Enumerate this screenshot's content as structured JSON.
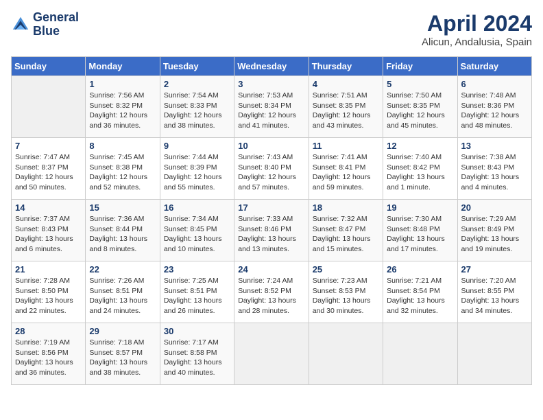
{
  "logo": {
    "line1": "General",
    "line2": "Blue"
  },
  "title": "April 2024",
  "subtitle": "Alicun, Andalusia, Spain",
  "days_header": [
    "Sunday",
    "Monday",
    "Tuesday",
    "Wednesday",
    "Thursday",
    "Friday",
    "Saturday"
  ],
  "weeks": [
    [
      {
        "num": "",
        "sunrise": "",
        "sunset": "",
        "daylight": ""
      },
      {
        "num": "1",
        "sunrise": "Sunrise: 7:56 AM",
        "sunset": "Sunset: 8:32 PM",
        "daylight": "Daylight: 12 hours and 36 minutes."
      },
      {
        "num": "2",
        "sunrise": "Sunrise: 7:54 AM",
        "sunset": "Sunset: 8:33 PM",
        "daylight": "Daylight: 12 hours and 38 minutes."
      },
      {
        "num": "3",
        "sunrise": "Sunrise: 7:53 AM",
        "sunset": "Sunset: 8:34 PM",
        "daylight": "Daylight: 12 hours and 41 minutes."
      },
      {
        "num": "4",
        "sunrise": "Sunrise: 7:51 AM",
        "sunset": "Sunset: 8:35 PM",
        "daylight": "Daylight: 12 hours and 43 minutes."
      },
      {
        "num": "5",
        "sunrise": "Sunrise: 7:50 AM",
        "sunset": "Sunset: 8:35 PM",
        "daylight": "Daylight: 12 hours and 45 minutes."
      },
      {
        "num": "6",
        "sunrise": "Sunrise: 7:48 AM",
        "sunset": "Sunset: 8:36 PM",
        "daylight": "Daylight: 12 hours and 48 minutes."
      }
    ],
    [
      {
        "num": "7",
        "sunrise": "Sunrise: 7:47 AM",
        "sunset": "Sunset: 8:37 PM",
        "daylight": "Daylight: 12 hours and 50 minutes."
      },
      {
        "num": "8",
        "sunrise": "Sunrise: 7:45 AM",
        "sunset": "Sunset: 8:38 PM",
        "daylight": "Daylight: 12 hours and 52 minutes."
      },
      {
        "num": "9",
        "sunrise": "Sunrise: 7:44 AM",
        "sunset": "Sunset: 8:39 PM",
        "daylight": "Daylight: 12 hours and 55 minutes."
      },
      {
        "num": "10",
        "sunrise": "Sunrise: 7:43 AM",
        "sunset": "Sunset: 8:40 PM",
        "daylight": "Daylight: 12 hours and 57 minutes."
      },
      {
        "num": "11",
        "sunrise": "Sunrise: 7:41 AM",
        "sunset": "Sunset: 8:41 PM",
        "daylight": "Daylight: 12 hours and 59 minutes."
      },
      {
        "num": "12",
        "sunrise": "Sunrise: 7:40 AM",
        "sunset": "Sunset: 8:42 PM",
        "daylight": "Daylight: 13 hours and 1 minute."
      },
      {
        "num": "13",
        "sunrise": "Sunrise: 7:38 AM",
        "sunset": "Sunset: 8:43 PM",
        "daylight": "Daylight: 13 hours and 4 minutes."
      }
    ],
    [
      {
        "num": "14",
        "sunrise": "Sunrise: 7:37 AM",
        "sunset": "Sunset: 8:43 PM",
        "daylight": "Daylight: 13 hours and 6 minutes."
      },
      {
        "num": "15",
        "sunrise": "Sunrise: 7:36 AM",
        "sunset": "Sunset: 8:44 PM",
        "daylight": "Daylight: 13 hours and 8 minutes."
      },
      {
        "num": "16",
        "sunrise": "Sunrise: 7:34 AM",
        "sunset": "Sunset: 8:45 PM",
        "daylight": "Daylight: 13 hours and 10 minutes."
      },
      {
        "num": "17",
        "sunrise": "Sunrise: 7:33 AM",
        "sunset": "Sunset: 8:46 PM",
        "daylight": "Daylight: 13 hours and 13 minutes."
      },
      {
        "num": "18",
        "sunrise": "Sunrise: 7:32 AM",
        "sunset": "Sunset: 8:47 PM",
        "daylight": "Daylight: 13 hours and 15 minutes."
      },
      {
        "num": "19",
        "sunrise": "Sunrise: 7:30 AM",
        "sunset": "Sunset: 8:48 PM",
        "daylight": "Daylight: 13 hours and 17 minutes."
      },
      {
        "num": "20",
        "sunrise": "Sunrise: 7:29 AM",
        "sunset": "Sunset: 8:49 PM",
        "daylight": "Daylight: 13 hours and 19 minutes."
      }
    ],
    [
      {
        "num": "21",
        "sunrise": "Sunrise: 7:28 AM",
        "sunset": "Sunset: 8:50 PM",
        "daylight": "Daylight: 13 hours and 22 minutes."
      },
      {
        "num": "22",
        "sunrise": "Sunrise: 7:26 AM",
        "sunset": "Sunset: 8:51 PM",
        "daylight": "Daylight: 13 hours and 24 minutes."
      },
      {
        "num": "23",
        "sunrise": "Sunrise: 7:25 AM",
        "sunset": "Sunset: 8:51 PM",
        "daylight": "Daylight: 13 hours and 26 minutes."
      },
      {
        "num": "24",
        "sunrise": "Sunrise: 7:24 AM",
        "sunset": "Sunset: 8:52 PM",
        "daylight": "Daylight: 13 hours and 28 minutes."
      },
      {
        "num": "25",
        "sunrise": "Sunrise: 7:23 AM",
        "sunset": "Sunset: 8:53 PM",
        "daylight": "Daylight: 13 hours and 30 minutes."
      },
      {
        "num": "26",
        "sunrise": "Sunrise: 7:21 AM",
        "sunset": "Sunset: 8:54 PM",
        "daylight": "Daylight: 13 hours and 32 minutes."
      },
      {
        "num": "27",
        "sunrise": "Sunrise: 7:20 AM",
        "sunset": "Sunset: 8:55 PM",
        "daylight": "Daylight: 13 hours and 34 minutes."
      }
    ],
    [
      {
        "num": "28",
        "sunrise": "Sunrise: 7:19 AM",
        "sunset": "Sunset: 8:56 PM",
        "daylight": "Daylight: 13 hours and 36 minutes."
      },
      {
        "num": "29",
        "sunrise": "Sunrise: 7:18 AM",
        "sunset": "Sunset: 8:57 PM",
        "daylight": "Daylight: 13 hours and 38 minutes."
      },
      {
        "num": "30",
        "sunrise": "Sunrise: 7:17 AM",
        "sunset": "Sunset: 8:58 PM",
        "daylight": "Daylight: 13 hours and 40 minutes."
      },
      {
        "num": "",
        "sunrise": "",
        "sunset": "",
        "daylight": ""
      },
      {
        "num": "",
        "sunrise": "",
        "sunset": "",
        "daylight": ""
      },
      {
        "num": "",
        "sunrise": "",
        "sunset": "",
        "daylight": ""
      },
      {
        "num": "",
        "sunrise": "",
        "sunset": "",
        "daylight": ""
      }
    ]
  ]
}
